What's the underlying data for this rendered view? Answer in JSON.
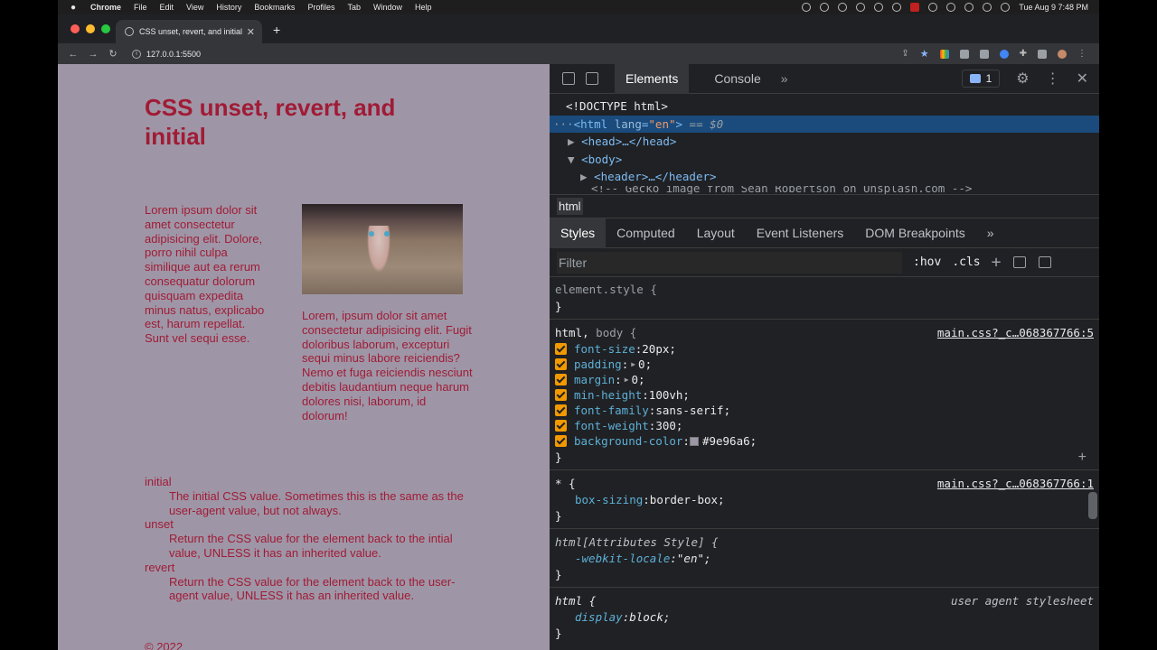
{
  "menubar": {
    "app": "Chrome",
    "items": [
      "File",
      "Edit",
      "View",
      "History",
      "Bookmarks",
      "Profiles",
      "Tab",
      "Window",
      "Help"
    ],
    "datetime": "Tue Aug 9  7:48 PM"
  },
  "browser": {
    "tab_title": "CSS unset, revert, and initial",
    "url": "127.0.0.1:5500"
  },
  "page": {
    "heading": "CSS unset, revert, and initial",
    "col1_text": "Lorem ipsum dolor sit amet consectetur adipisicing elit. Dolore, porro nihil culpa similique aut ea rerum consequatur dolorum quisquam expedita minus natus, explicabo est, harum repellat. Sunt vel sequi esse.",
    "col2_text": "Lorem, ipsum dolor sit amet consectetur adipisicing elit. Fugit doloribus laborum, excepturi sequi minus labore reiciendis? Nemo et fuga reiciendis nesciunt debitis laudantium neque harum dolores nisi, laborum, id dolorum!",
    "definitions": [
      {
        "term": "initial",
        "desc": "The initial CSS value. Sometimes this is the same as the user-agent value, but not always."
      },
      {
        "term": "unset",
        "desc": "Return the CSS value for the element back to the intial value, UNLESS it has an inherited value."
      },
      {
        "term": "revert",
        "desc": "Return the CSS value for the element back to the user-agent value, UNLESS it has an inherited value."
      }
    ],
    "footer": "© 2022",
    "background_color": "#9e96a6",
    "text_color": "#a11b36"
  },
  "devtools": {
    "tabs": {
      "elements": "Elements",
      "console": "Console",
      "more": "»"
    },
    "issues_count": "1",
    "dom": {
      "doctype": "<!DOCTYPE html>",
      "html_open": "<html",
      "html_attr_name": "lang",
      "html_attr_value": "\"en\"",
      "html_close_bracket": ">",
      "html_suffix": " == $0",
      "head": "<head>…</head>",
      "body": "<body>",
      "header": "<header>…</header>",
      "comment": "<!-- Gecko image from Sean Robertson on Unsplash.com -->"
    },
    "breadcrumb": "html",
    "subtabs": [
      "Styles",
      "Computed",
      "Layout",
      "Event Listeners",
      "DOM Breakpoints",
      "»"
    ],
    "filter_placeholder": "Filter",
    "hov": ":hov",
    "cls": ".cls",
    "rules": {
      "element_style": "element.style {",
      "close": "}",
      "r1_selector_main": "html,",
      "r1_selector_dim": " body ",
      "r1_selector_brace": "{",
      "r1_source": "main.css?_c…068367766:5",
      "r1_props": [
        {
          "name": "font-size",
          "value": "20px;"
        },
        {
          "name": "padding",
          "value": "0;",
          "expand": true
        },
        {
          "name": "margin",
          "value": "0;",
          "expand": true
        },
        {
          "name": "min-height",
          "value": "100vh;"
        },
        {
          "name": "font-family",
          "value": "sans-serif;"
        },
        {
          "name": "font-weight",
          "value": "300;"
        },
        {
          "name": "background-color",
          "value": "#9e96a6;",
          "swatch": true
        }
      ],
      "r2_selector": "* {",
      "r2_source": "main.css?_c…068367766:1",
      "r2_prop_name": "box-sizing",
      "r2_prop_value": "border-box;",
      "r3_selector": "html[Attributes Style] {",
      "r3_prop_name": "-webkit-locale",
      "r3_prop_value": "\"en\";",
      "r4_selector": "html {",
      "r4_source": "user agent stylesheet",
      "r4_prop_name": "display",
      "r4_prop_value": "block;"
    }
  }
}
